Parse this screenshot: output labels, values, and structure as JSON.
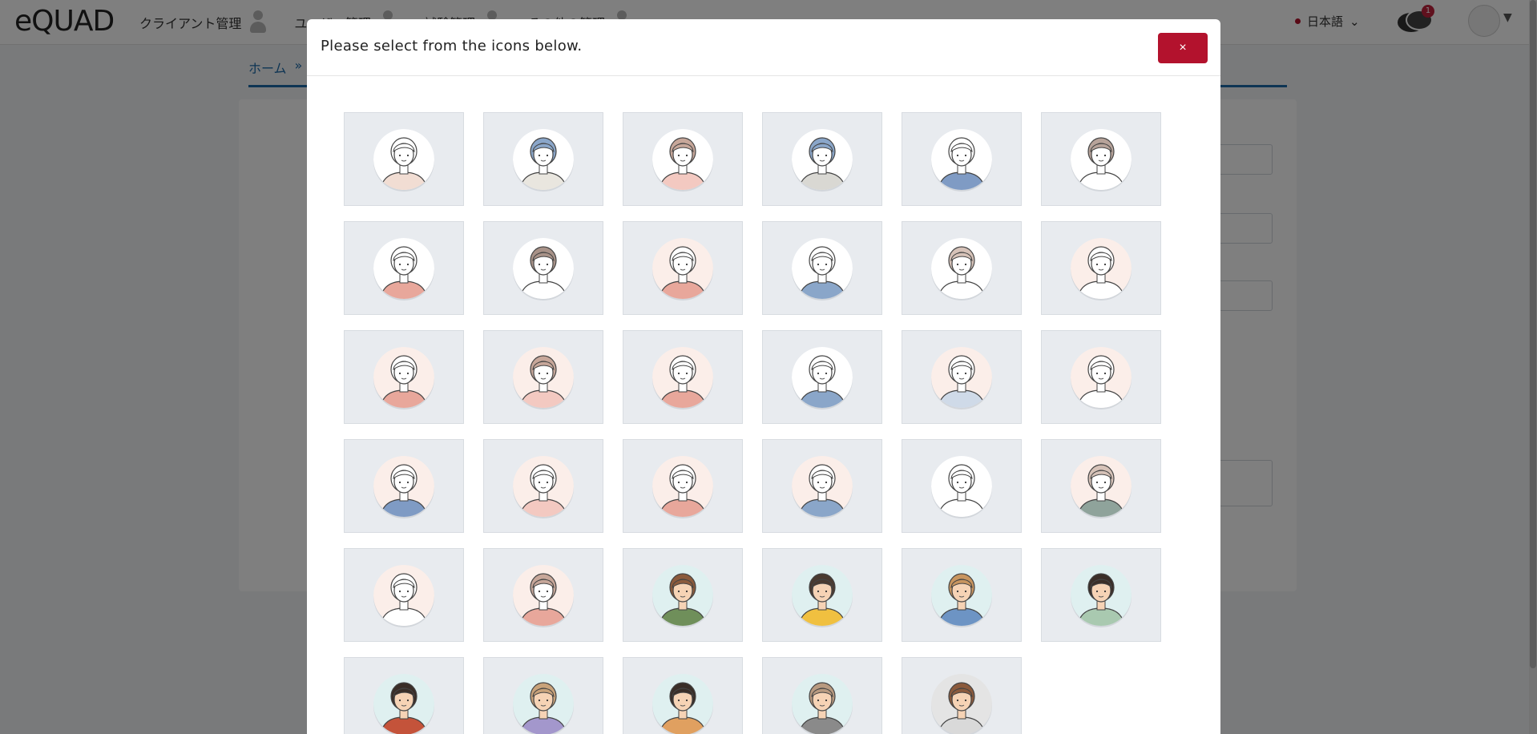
{
  "app": {
    "logo_text": "eQUAD",
    "nav": [
      {
        "label": "クライアント管理"
      },
      {
        "label": "ユーザー管理"
      },
      {
        "label": "試験管理"
      },
      {
        "label": "その他の管理"
      }
    ],
    "language": "日本語",
    "chat_badge": "1",
    "breadcrumb_home": "ホーム",
    "breadcrumb_sep": "»"
  },
  "modal": {
    "title": "Please select from the icons below.",
    "close_label": "×"
  },
  "colors": {
    "brand_red": "#b3122d",
    "link_blue": "#1c6aa8",
    "tile_bg": "#e8ebef"
  },
  "avatars": [
    {
      "icon": "avatar-woman-short-hair-icon",
      "bg": "#ffffff",
      "hair": "#ffffff",
      "shirt": "#f1ddd3",
      "skin": "#ffffff"
    },
    {
      "icon": "avatar-man-suit-blue-hair-icon",
      "bg": "#ffffff",
      "hair": "#8aa6c9",
      "shirt": "#e9e6df",
      "skin": "#ffffff"
    },
    {
      "icon": "avatar-woman-bob-icon",
      "bg": "#ffffff",
      "hair": "#c7a79a",
      "shirt": "#f3c9c1",
      "skin": "#ffffff"
    },
    {
      "icon": "avatar-woman-long-blue-hair-icon",
      "bg": "#ffffff",
      "hair": "#8aa6c9",
      "shirt": "#d9d8d3",
      "skin": "#ffffff"
    },
    {
      "icon": "avatar-man-blue-suit-icon",
      "bg": "#ffffff",
      "hair": "#ffffff",
      "shirt": "#7f9bc4",
      "skin": "#ffffff"
    },
    {
      "icon": "avatar-man-tie-icon",
      "bg": "#ffffff",
      "hair": "#b7a39a",
      "shirt": "#ffffff",
      "skin": "#ffffff"
    },
    {
      "icon": "avatar-woman-pink-top-icon",
      "bg": "#ffffff",
      "hair": "#ffffff",
      "shirt": "#e8a79b",
      "skin": "#ffffff"
    },
    {
      "icon": "avatar-man-curly-hair-icon",
      "bg": "#ffffff",
      "hair": "#a89288",
      "shirt": "#ffffff",
      "skin": "#ffffff"
    },
    {
      "icon": "avatar-woman-ponytail-icon",
      "bg": "#fbeee9",
      "hair": "#ffffff",
      "shirt": "#e8a79b",
      "skin": "#ffffff"
    },
    {
      "icon": "avatar-man-blue-sweater-icon",
      "bg": "#ffffff",
      "hair": "#ffffff",
      "shirt": "#8aa6c9",
      "skin": "#ffffff"
    },
    {
      "icon": "avatar-woman-wavy-hair-icon",
      "bg": "#ffffff",
      "hair": "#d6c2b8",
      "shirt": "#ffffff",
      "skin": "#ffffff"
    },
    {
      "icon": "avatar-woman-collar-icon",
      "bg": "#fbeee9",
      "hair": "#ffffff",
      "shirt": "#ffffff",
      "skin": "#ffffff"
    },
    {
      "icon": "avatar-woman-bun-icon",
      "bg": "#fbeee9",
      "hair": "#ffffff",
      "shirt": "#e8a79b",
      "skin": "#ffffff"
    },
    {
      "icon": "avatar-woman-long-hair-icon",
      "bg": "#fbeee9",
      "hair": "#c7a79a",
      "shirt": "#f3c9c1",
      "skin": "#ffffff"
    },
    {
      "icon": "avatar-woman-curly-hair-icon",
      "bg": "#fbeee9",
      "hair": "#ffffff",
      "shirt": "#e8a79b",
      "skin": "#ffffff"
    },
    {
      "icon": "avatar-man-navy-sweater-icon",
      "bg": "#ffffff",
      "hair": "#ffffff",
      "shirt": "#8aa6c9",
      "skin": "#ffffff"
    },
    {
      "icon": "avatar-man-striped-shirt-icon",
      "bg": "#fbeee9",
      "hair": "#ffffff",
      "shirt": "#cfdae8",
      "skin": "#ffffff"
    },
    {
      "icon": "avatar-man-blue-tie-icon",
      "bg": "#fbeee9",
      "hair": "#ffffff",
      "shirt": "#ffffff",
      "skin": "#ffffff"
    },
    {
      "icon": "avatar-woman-denim-jacket-icon",
      "bg": "#fbeee9",
      "hair": "#ffffff",
      "shirt": "#7f9bc4",
      "skin": "#ffffff"
    },
    {
      "icon": "avatar-man-pink-shirt-icon",
      "bg": "#fbeee9",
      "hair": "#ffffff",
      "shirt": "#f3c9c1",
      "skin": "#ffffff"
    },
    {
      "icon": "avatar-woman-profile-bun-icon",
      "bg": "#fbeee9",
      "hair": "#ffffff",
      "shirt": "#e8a79b",
      "skin": "#ffffff"
    },
    {
      "icon": "avatar-man-profile-blue-icon",
      "bg": "#fbeee9",
      "hair": "#ffffff",
      "shirt": "#8aa6c9",
      "skin": "#ffffff"
    },
    {
      "icon": "avatar-woman-profile-ponytail-icon",
      "bg": "#ffffff",
      "hair": "#ffffff",
      "shirt": "#ffffff",
      "skin": "#ffffff"
    },
    {
      "icon": "avatar-woman-profile-green-icon",
      "bg": "#fbeee9",
      "hair": "#d6c2b8",
      "shirt": "#8fa39b",
      "skin": "#ffffff"
    },
    {
      "icon": "avatar-woman-profile-bob-icon",
      "bg": "#fbeee9",
      "hair": "#ffffff",
      "shirt": "#ffffff",
      "skin": "#ffffff"
    },
    {
      "icon": "avatar-woman-profile-long-icon",
      "bg": "#fbeee9",
      "hair": "#c7a79a",
      "shirt": "#e8a79b",
      "skin": "#ffffff"
    },
    {
      "icon": "avatar-man-waving-green-icon",
      "bg": "#dff0f0",
      "hair": "#8b5a3c",
      "shirt": "#6f8f5a",
      "skin": "#f6d3b5"
    },
    {
      "icon": "avatar-man-yellow-shirt-icon",
      "bg": "#dff0f0",
      "hair": "#4a3a30",
      "shirt": "#f0c040",
      "skin": "#f6d3b5"
    },
    {
      "icon": "avatar-man-denim-sparkle-icon",
      "bg": "#dff0f0",
      "hair": "#c8955f",
      "shirt": "#6d94c4",
      "skin": "#f6d3b5"
    },
    {
      "icon": "avatar-man-thinking-icon",
      "bg": "#dff0f0",
      "hair": "#3a2e28",
      "shirt": "#a9c9b0",
      "skin": "#f6d3b5"
    },
    {
      "icon": "avatar-boy-red-shirt-icon",
      "bg": "#dff0f0",
      "hair": "#3a2e28",
      "shirt": "#c4533a",
      "skin": "#f6d3b5"
    },
    {
      "icon": "avatar-man-purple-peace-icon",
      "bg": "#dff0f0",
      "hair": "#c8a27a",
      "shirt": "#a397cc",
      "skin": "#f6d3b5"
    },
    {
      "icon": "avatar-man-orange-shirt-icon",
      "bg": "#dff0f0",
      "hair": "#3a2e28",
      "shirt": "#e0a060",
      "skin": "#f6d3b5"
    },
    {
      "icon": "avatar-man-striped-smile-icon",
      "bg": "#dff0f0",
      "hair": "#b89a80",
      "shirt": "#8a8a8a",
      "skin": "#f6d3b5"
    },
    {
      "icon": "avatar-woman-call-center-icon",
      "bg": "#e4e4e4",
      "hair": "#8b5a3c",
      "shirt": "#d9d9d9",
      "skin": "#f6d3b5"
    }
  ]
}
